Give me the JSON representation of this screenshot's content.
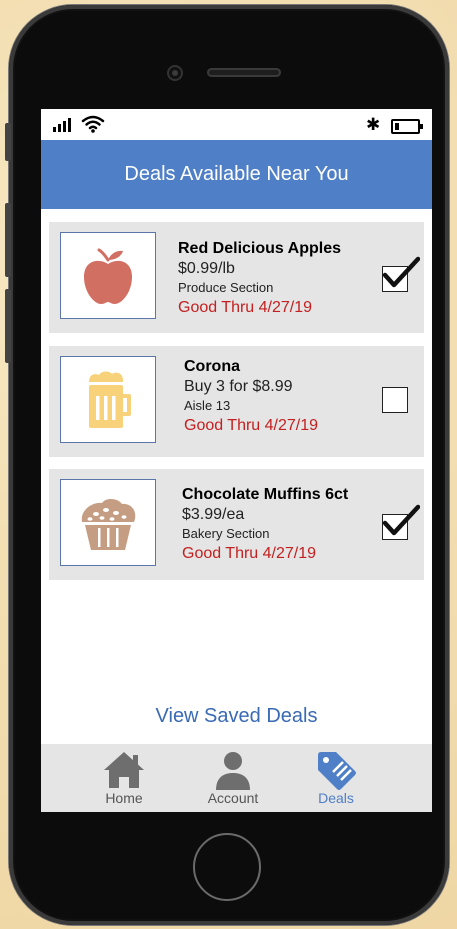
{
  "header": {
    "title": "Deals Available Near You"
  },
  "status_bar": {
    "bluetooth_icon": "bluetooth-icon",
    "battery_icon": "battery-icon"
  },
  "deals": [
    {
      "name": "Red Delicious Apples",
      "price": "$0.99/lb",
      "location": "Produce Section",
      "valid": "Good Thru 4/27/19",
      "icon": "apple-icon",
      "icon_color": "#d26f63",
      "checked": true
    },
    {
      "name": "Corona",
      "price": "Buy 3 for $8.99",
      "location": "Aisle 13",
      "valid": "Good Thru 4/27/19",
      "icon": "beer-mug-icon",
      "icon_color": "#f7d27a",
      "checked": false
    },
    {
      "name": "Chocolate Muffins 6ct",
      "price": "$3.99/ea",
      "location": "Bakery Section",
      "valid": "Good Thru 4/27/19",
      "icon": "muffin-icon",
      "icon_color": "#c59d82",
      "checked": true
    }
  ],
  "links": {
    "view_saved": "View Saved Deals"
  },
  "tabs": [
    {
      "label": "Home",
      "icon": "home-icon",
      "active": false
    },
    {
      "label": "Account",
      "icon": "account-icon",
      "active": false
    },
    {
      "label": "Deals",
      "icon": "tag-icon",
      "active": true
    }
  ],
  "colors": {
    "header": "#4f7fc6",
    "card_background": "#e5e5e5",
    "valid_text": "#c42020",
    "link": "#3a6ab3",
    "tab_inactive_icon": "#6e6e6e",
    "tab_active": "#4f7fc6"
  }
}
